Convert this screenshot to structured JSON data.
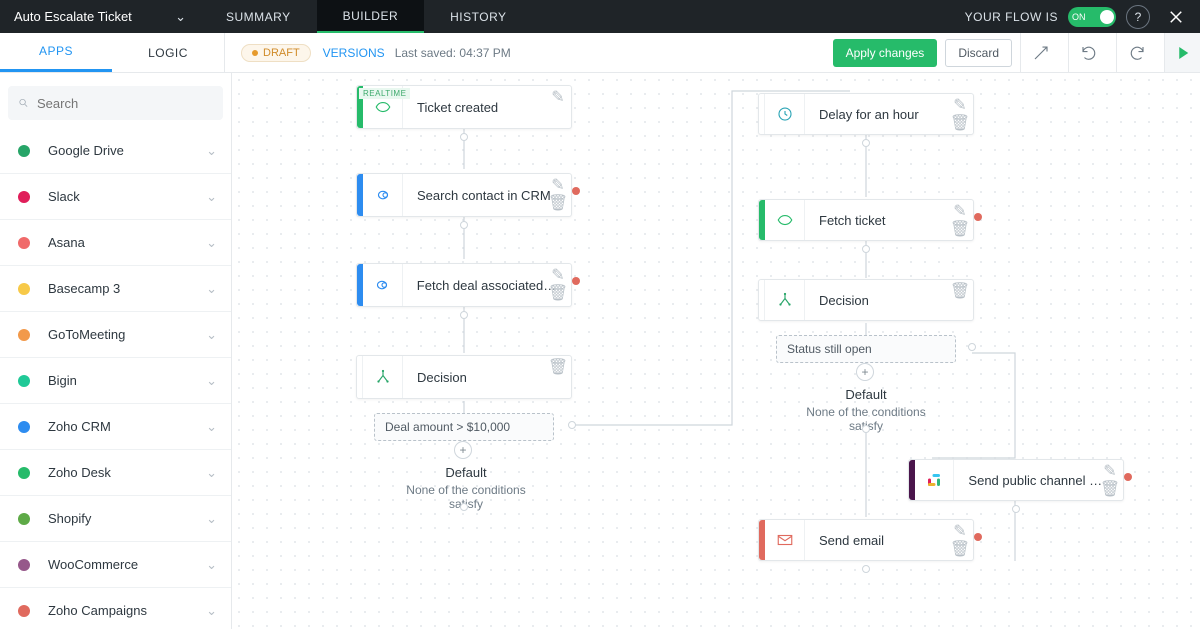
{
  "header": {
    "flow_name": "Auto Escalate Ticket",
    "tabs": [
      "SUMMARY",
      "BUILDER",
      "HISTORY"
    ],
    "active_tab": 1,
    "status_label": "YOUR FLOW IS",
    "toggle_state": "ON"
  },
  "subheader": {
    "tabs": [
      "APPS",
      "LOGIC"
    ],
    "active_tab": 0,
    "draft_label": "DRAFT",
    "versions_label": "VERSIONS",
    "last_saved_prefix": "Last saved:",
    "last_saved_time": "04:37 PM",
    "apply_label": "Apply changes",
    "discard_label": "Discard"
  },
  "search": {
    "placeholder": "Search"
  },
  "apps": [
    {
      "name": "Google Drive",
      "color1": "#27a568",
      "color2": "#f7c948",
      "color3": "#2d8cf0"
    },
    {
      "name": "Slack",
      "color1": "#e01e5a"
    },
    {
      "name": "Asana",
      "color1": "#f06a6a"
    },
    {
      "name": "Basecamp 3",
      "color1": "#f7c948"
    },
    {
      "name": "GoToMeeting",
      "color1": "#f2994a"
    },
    {
      "name": "Bigin",
      "color1": "#20c997"
    },
    {
      "name": "Zoho CRM",
      "color1": "#2d8cf0"
    },
    {
      "name": "Zoho Desk",
      "color1": "#26bb6a"
    },
    {
      "name": "Shopify",
      "color1": "#5eaa47"
    },
    {
      "name": "WooCommerce",
      "color1": "#96588a"
    },
    {
      "name": "Zoho Campaigns",
      "color1": "#e06a5e"
    }
  ],
  "canvas": {
    "nodes": {
      "trigger": {
        "label": "Ticket created",
        "badge": "REALTIME",
        "accent": "#26bb6a"
      },
      "search": {
        "label": "Search contact in CRM",
        "accent": "#2d8cf0"
      },
      "fetchdeal": {
        "label": "Fetch deal associated ...",
        "accent": "#2d8cf0"
      },
      "decision1": {
        "label": "Decision",
        "accent": "#ffffff"
      },
      "delay": {
        "label": "Delay for an hour",
        "accent": "#ffffff"
      },
      "fetchtkt": {
        "label": "Fetch ticket",
        "accent": "#26bb6a"
      },
      "decision2": {
        "label": "Decision",
        "accent": "#ffffff"
      },
      "slackmsg": {
        "label": "Send public channel m...",
        "accent": "#4a154b"
      },
      "email": {
        "label": "Send email",
        "accent": "#e06a5e"
      }
    },
    "conditions": {
      "c1": "Deal amount > $10,000",
      "c2": "Status still open"
    },
    "default": {
      "title": "Default",
      "subtitle": "None of the conditions satisfy"
    }
  }
}
